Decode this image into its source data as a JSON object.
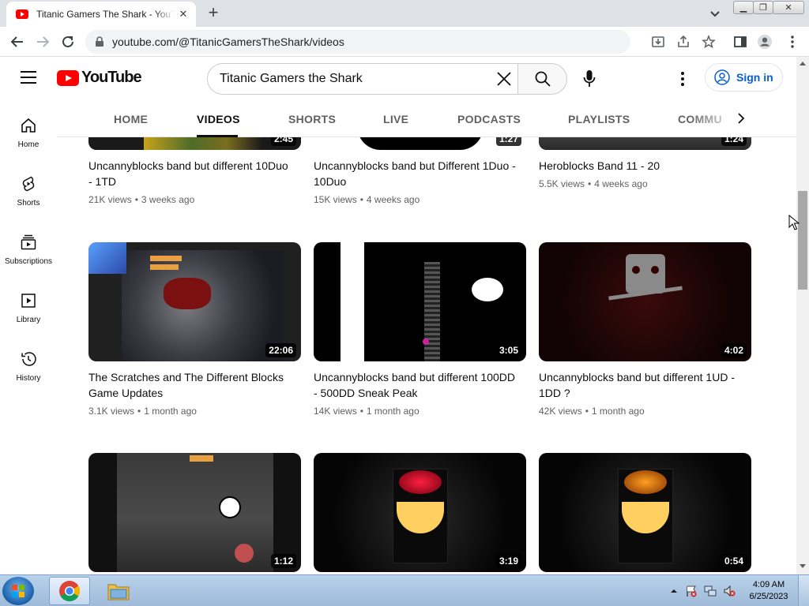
{
  "browser": {
    "tab_title": "Titanic Gamers The Shark - YouTube",
    "new_tab_icon": "+",
    "url": "youtube.com/@TitanicGamersTheShark/videos"
  },
  "youtube": {
    "logo_text": "YouTube",
    "search_value": "Titanic Gamers the Shark",
    "sign_in": "Sign in",
    "guide": [
      {
        "label": "Home"
      },
      {
        "label": "Shorts"
      },
      {
        "label": "Subscriptions"
      },
      {
        "label": "Library"
      },
      {
        "label": "History"
      }
    ],
    "tabs": [
      {
        "label": "HOME"
      },
      {
        "label": "VIDEOS"
      },
      {
        "label": "SHORTS"
      },
      {
        "label": "LIVE"
      },
      {
        "label": "PODCASTS"
      },
      {
        "label": "PLAYLISTS"
      },
      {
        "label": "COMMU"
      }
    ],
    "videos": [
      {
        "title": "Uncannyblocks band but different 10Duo - 1TD",
        "views": "21K views",
        "age": "3 weeks ago",
        "duration": "2:45"
      },
      {
        "title": "Uncannyblocks band but Different 1Duo - 10Duo",
        "views": "15K views",
        "age": "4 weeks ago",
        "duration": "1:27"
      },
      {
        "title": "Heroblocks Band 11 - 20",
        "views": "5.5K views",
        "age": "4 weeks ago",
        "duration": "1:24"
      },
      {
        "title": "The Scratches and The Different Blocks Game Updates",
        "views": "3.1K views",
        "age": "1 month ago",
        "duration": "22:06"
      },
      {
        "title": "Uncannyblocks band but different 100DD - 500DD Sneak Peak",
        "views": "14K views",
        "age": "1 month ago",
        "duration": "3:05"
      },
      {
        "title": "Uncannyblocks band but different 1UD - 1DD ?",
        "views": "42K views",
        "age": "1 month ago",
        "duration": "4:02"
      },
      {
        "title": "",
        "views": "",
        "age": "",
        "duration": "1:12"
      },
      {
        "title": "",
        "views": "",
        "age": "",
        "duration": "3:19"
      },
      {
        "title": "",
        "views": "",
        "age": "",
        "duration": "0:54"
      }
    ],
    "meta_separator": "•"
  },
  "taskbar": {
    "time": "4:09 AM",
    "date": "6/25/2023"
  },
  "colors": {
    "brand_red": "#ff0000",
    "link_blue": "#065fd4",
    "taskbar": "#b9d1ea"
  }
}
